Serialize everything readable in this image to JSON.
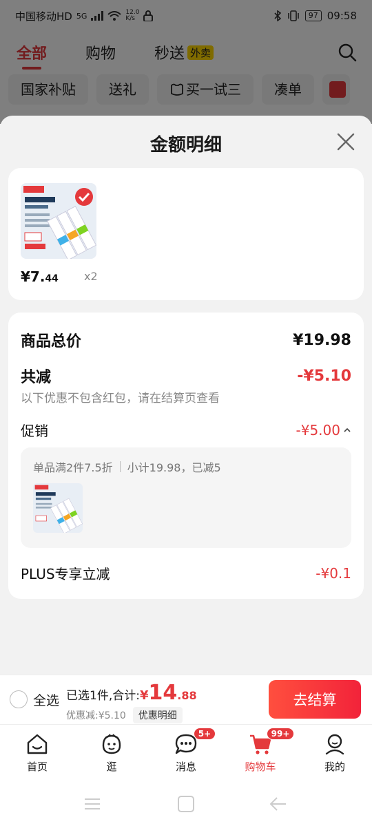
{
  "status_bar": {
    "carrier": "中国移动HD",
    "network": "5G",
    "speed_value": "12.0",
    "speed_unit": "K/s",
    "battery": "97",
    "time": "09:58"
  },
  "top_tabs": [
    "全部",
    "购物",
    "秒送"
  ],
  "waimai_badge": "外卖",
  "chips": [
    "国家补贴",
    "送礼",
    "买一试三",
    "凑单"
  ],
  "sheet": {
    "title": "金额明细"
  },
  "item": {
    "price_int": "¥7.",
    "price_dec": "44",
    "qty": "x2"
  },
  "summary": {
    "total_label": "商品总价",
    "total_value": "¥19.98",
    "reduce_label": "共减",
    "reduce_value": "-¥5.10",
    "note": "以下优惠不包含红包，请在结算页查看",
    "promo_label": "促销",
    "promo_value": "-¥5.00",
    "promo_rule": "单品满2件7.5折",
    "promo_subtotal": "小计19.98，已减5",
    "plus_label": "PLUS专享立减",
    "plus_value": "-¥0.1"
  },
  "checkout": {
    "select_all": "全选",
    "selected_text": "已选1件,合计:",
    "yen": "¥",
    "total_int": "14",
    "total_dec": ".88",
    "discount": "优惠减:¥5.10",
    "detail_button": "优惠明细",
    "checkout_button": "去结算"
  },
  "nav": {
    "items": [
      {
        "label": "首页",
        "icon": "home-icon"
      },
      {
        "label": "逛",
        "icon": "browse-icon"
      },
      {
        "label": "消息",
        "icon": "message-icon",
        "badge": "5+"
      },
      {
        "label": "购物车",
        "icon": "cart-icon",
        "badge": "99+"
      },
      {
        "label": "我的",
        "icon": "profile-icon"
      }
    ]
  },
  "colors": {
    "accent": "#e4393c",
    "checkout_gradient_start": "#ff4f3e",
    "checkout_gradient_end": "#f2233a"
  }
}
